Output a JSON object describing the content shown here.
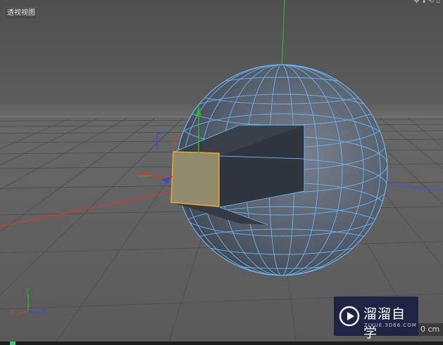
{
  "viewport": {
    "label": "透视视图",
    "scale_readout": "0 cm"
  },
  "axis_gizmo": {
    "x": "X",
    "y": "Y",
    "z": "Z"
  },
  "watermark": {
    "title": "溜溜自学",
    "url": "ZIXUE.3D66.COM"
  },
  "icons": {
    "view_menu": "viewport-nav-icons",
    "logo": "play-logo-icon",
    "status": "status-indicator-icon"
  },
  "colors": {
    "viewport_bg": "#5a5a5a",
    "object_fill": "#566170",
    "wireframe": "#6cb2ee",
    "selected_face": "#8f8b6b",
    "selected_edge": "#f2a33a",
    "axis_x": "#d53a32",
    "axis_y": "#2bb52b",
    "axis_z": "#2b49d6"
  }
}
